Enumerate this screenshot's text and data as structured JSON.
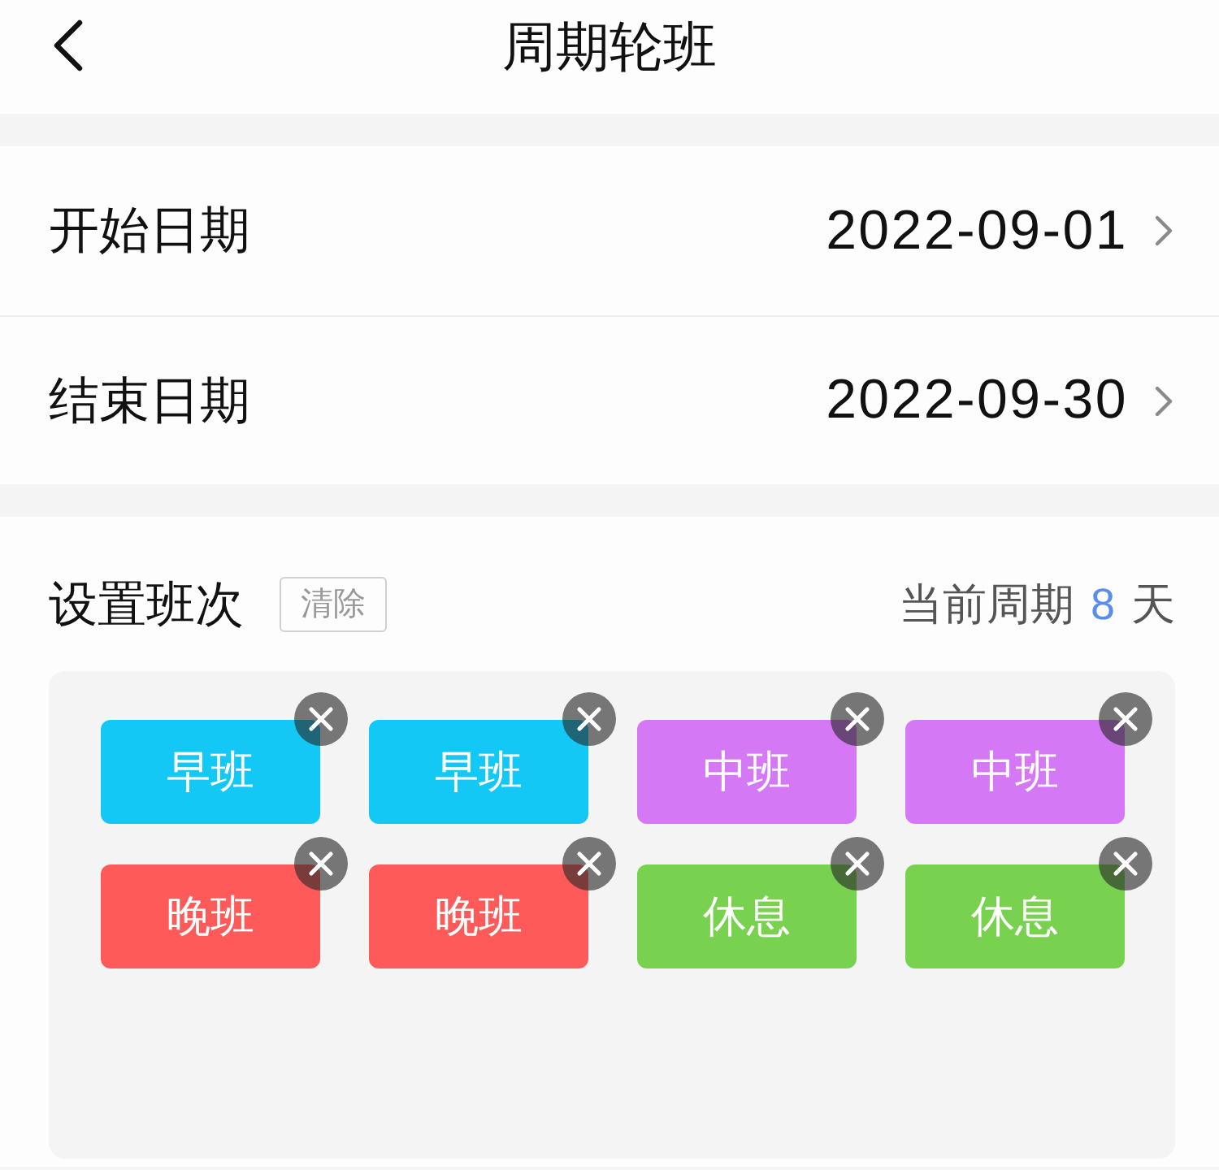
{
  "header": {
    "title": "周期轮班"
  },
  "dates": [
    {
      "label": "开始日期",
      "value": "2022-09-01"
    },
    {
      "label": "结束日期",
      "value": "2022-09-30"
    }
  ],
  "shift_section": {
    "title": "设置班次",
    "clear_button": "清除",
    "cycle_label": "当前周期",
    "cycle_days": "8",
    "cycle_unit": "天",
    "shifts": [
      {
        "label": "早班",
        "color": "#14c8f5"
      },
      {
        "label": "早班",
        "color": "#14c8f5"
      },
      {
        "label": "中班",
        "color": "#d478f5"
      },
      {
        "label": "中班",
        "color": "#d478f5"
      },
      {
        "label": "晚班",
        "color": "#ff5a5a"
      },
      {
        "label": "晚班",
        "color": "#ff5a5a"
      },
      {
        "label": "休息",
        "color": "#78d250"
      },
      {
        "label": "休息",
        "color": "#78d250"
      }
    ]
  }
}
